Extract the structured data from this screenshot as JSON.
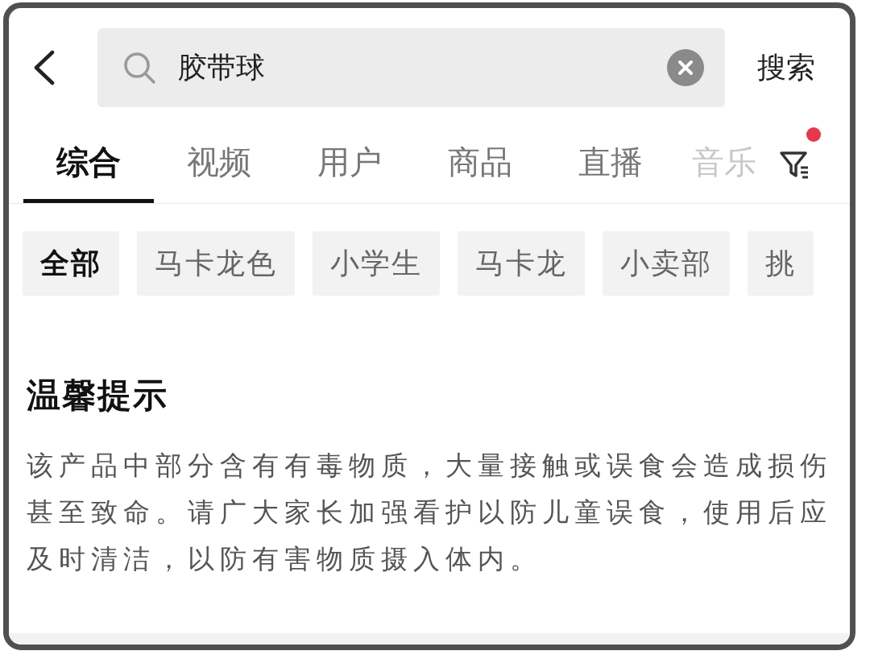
{
  "search": {
    "value": "胶带球",
    "button": "搜索"
  },
  "tabs": [
    {
      "label": "综合",
      "selected": true
    },
    {
      "label": "视频",
      "selected": false
    },
    {
      "label": "用户",
      "selected": false
    },
    {
      "label": "商品",
      "selected": false
    },
    {
      "label": "直播",
      "selected": false
    },
    {
      "label": "音乐",
      "selected": false
    }
  ],
  "filter": {
    "badge": true
  },
  "chips": [
    {
      "label": "全部",
      "selected": true
    },
    {
      "label": "马卡龙色",
      "selected": false
    },
    {
      "label": "小学生",
      "selected": false
    },
    {
      "label": "马卡龙",
      "selected": false
    },
    {
      "label": "小卖部",
      "selected": false
    },
    {
      "label": "挑",
      "selected": false
    }
  ],
  "notice": {
    "title": "温馨提示",
    "text": "该产品中部分含有有毒物质，大量接触或误食会造成损伤甚至致命。请广大家长加强看护以防儿童误食，使用后应及时清洁，以防有害物质摄入体内。"
  }
}
